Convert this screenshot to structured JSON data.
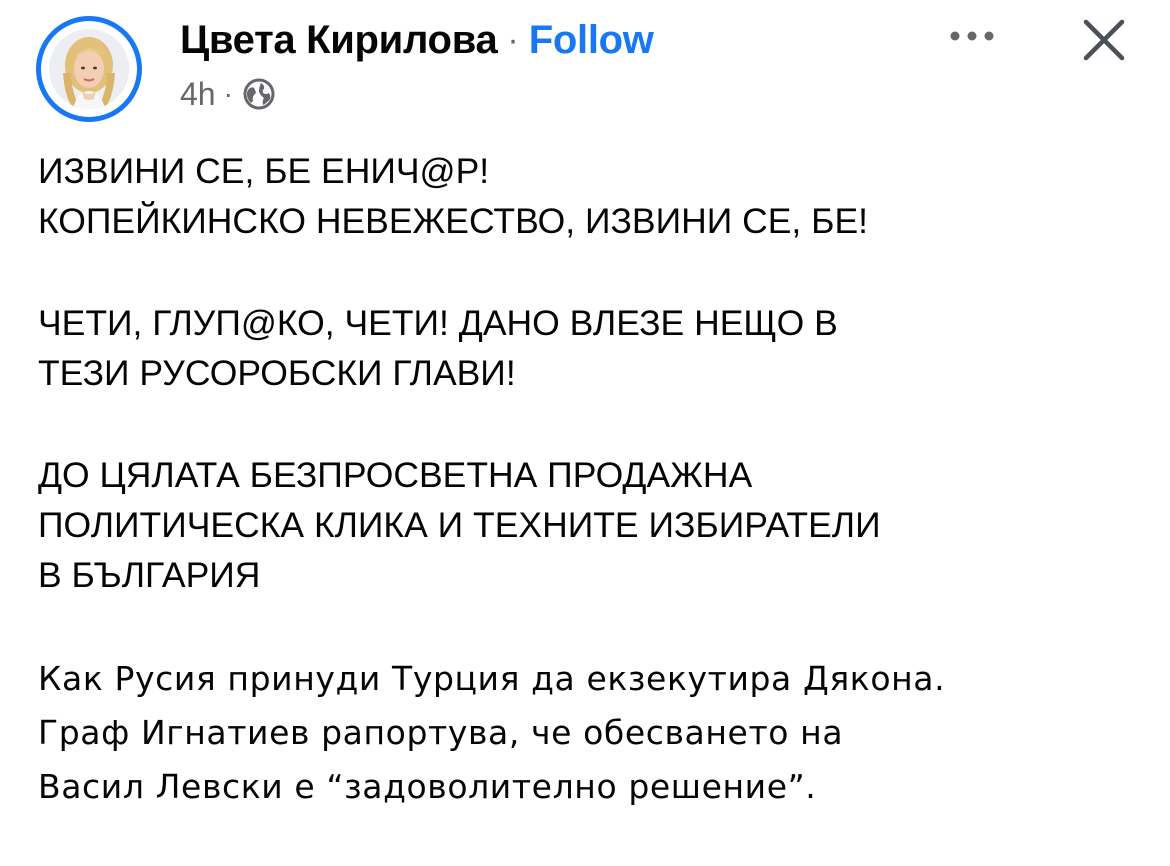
{
  "post": {
    "author_name": "Цвета Кирилова",
    "name_separator": "·",
    "follow_label": "Follow",
    "time": "4h",
    "meta_separator": "·",
    "privacy_icon": "globe-icon",
    "more_icon": "more-horizontal-icon",
    "close_icon": "close-icon",
    "paragraphs": [
      [
        "ИЗВИНИ СЕ, БЕ ЕНИЧ@Р!",
        "КОПЕЙКИНСКО НЕВЕЖЕСТВО, ИЗВИНИ СЕ, БЕ!"
      ],
      [
        "ЧЕТИ, ГЛУП@КО, ЧЕТИ! ДАНО ВЛЕЗЕ НЕЩО В",
        "ТЕЗИ РУСОРОБСКИ ГЛАВИ!"
      ],
      [
        "ДО ЦЯЛАТА БЕЗПРОСВЕТНА ПРОДАЖНА",
        "ПОЛИТИЧЕСКА КЛИКА И ТЕХНИТЕ ИЗБИРАТЕЛИ",
        "В БЪЛГАРИЯ"
      ],
      [
        "Как Русия принуди Турция да екзекутира Дякона.",
        "Граф Игнатиев рапортува, че обесването на",
        "Васил Левски е “задоволително решение”."
      ]
    ]
  },
  "colors": {
    "accent": "#1877f2",
    "text_primary": "#050505",
    "text_secondary": "#65676b",
    "background": "#ffffff"
  }
}
